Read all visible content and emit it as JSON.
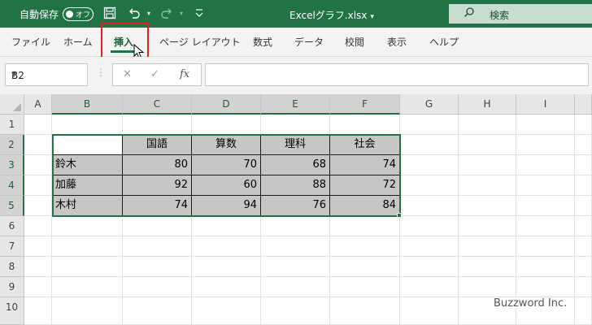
{
  "titlebar": {
    "autosave_label": "自動保存",
    "autosave_state": "オフ",
    "filename": "Excelグラフ.xlsx",
    "filename_caret": "▾",
    "search_placeholder": "検索",
    "icons": [
      "save-icon",
      "undo-icon",
      "redo-icon",
      "customize-qat-icon",
      "search-icon"
    ]
  },
  "ribbon": {
    "tabs": [
      {
        "label": "ファイル"
      },
      {
        "label": "ホーム"
      },
      {
        "label": "挿入",
        "active": true
      },
      {
        "label": "ページ レイアウト"
      },
      {
        "label": "数式"
      },
      {
        "label": "データ"
      },
      {
        "label": "校閲"
      },
      {
        "label": "表示"
      },
      {
        "label": "ヘルプ"
      }
    ]
  },
  "formula_bar": {
    "name_box": "B2",
    "cancel_symbol": "✕",
    "enter_symbol": "✓",
    "fx_symbol": "fx",
    "formula": ""
  },
  "sheet": {
    "columns": [
      "A",
      "B",
      "C",
      "D",
      "E",
      "F",
      "G",
      "H",
      "I"
    ],
    "selected_columns": [
      "B",
      "C",
      "D",
      "E",
      "F"
    ],
    "rows": [
      "1",
      "2",
      "3",
      "4",
      "5",
      "6",
      "7",
      "8",
      "9",
      "10"
    ],
    "selected_rows": [
      "2",
      "3",
      "4",
      "5"
    ],
    "table": {
      "headers": [
        "",
        "国語",
        "算数",
        "理科",
        "社会"
      ],
      "rows": [
        {
          "name": "鈴木",
          "values": [
            "80",
            "70",
            "68",
            "74"
          ]
        },
        {
          "name": "加藤",
          "values": [
            "92",
            "60",
            "88",
            "72"
          ]
        },
        {
          "name": "木村",
          "values": [
            "74",
            "94",
            "76",
            "84"
          ]
        }
      ]
    }
  },
  "colors": {
    "accent": "#217346",
    "highlight_box": "#e3221c",
    "table_fill": "#c6c6c6"
  },
  "watermark": "Buzzword Inc."
}
